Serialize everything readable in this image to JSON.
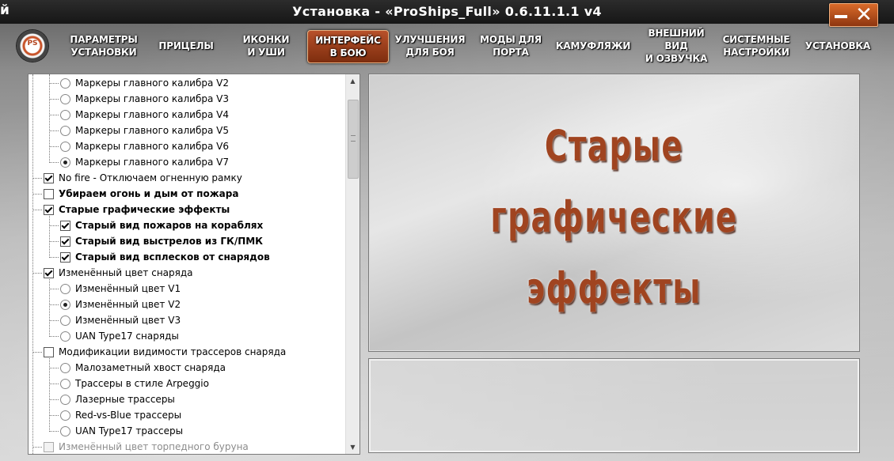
{
  "titlebar": {
    "edge_char": "й",
    "title": "Установка - «ProShips_Full» 0.6.11.1.1 v4"
  },
  "logo": {
    "text": "PS"
  },
  "nav": {
    "items": [
      {
        "label": "ПАРАМЕТРЫ\nУСТАНОВКИ",
        "active": false
      },
      {
        "label": "ПРИЦЕЛЫ",
        "active": false
      },
      {
        "label": "ИКОНКИ\nИ УШИ",
        "active": false
      },
      {
        "label": "ИНТЕРФЕЙС\nВ БОЮ",
        "active": true
      },
      {
        "label": "УЛУЧШЕНИЯ\nДЛЯ БОЯ",
        "active": false
      },
      {
        "label": "МОДЫ ДЛЯ\nПОРТА",
        "active": false
      },
      {
        "label": "КАМУФЛЯЖИ",
        "active": false
      },
      {
        "label": "ВНЕШНИЙ ВИД\nИ ОЗВУЧКА",
        "active": false
      },
      {
        "label": "СИСТЕМНЫЕ\nНАСТРОЙКИ",
        "active": false
      },
      {
        "label": "УСТАНОВКА",
        "active": false
      }
    ]
  },
  "tree": {
    "rows": [
      {
        "type": "radio",
        "level": 1,
        "label": "Маркеры главного калибра V2",
        "checked": false
      },
      {
        "type": "radio",
        "level": 1,
        "label": "Маркеры главного калибра V3",
        "checked": false
      },
      {
        "type": "radio",
        "level": 1,
        "label": "Маркеры главного калибра V4",
        "checked": false
      },
      {
        "type": "radio",
        "level": 1,
        "label": "Маркеры главного калибра V5",
        "checked": false
      },
      {
        "type": "radio",
        "level": 1,
        "label": "Маркеры главного калибра V6",
        "checked": false
      },
      {
        "type": "radio",
        "level": 1,
        "label": "Маркеры главного калибра V7",
        "checked": true
      },
      {
        "type": "check",
        "level": 0,
        "label": "No fire - Отключаем огненную рамку",
        "checked": true
      },
      {
        "type": "check",
        "level": 0,
        "label": "Убираем огонь и дым от пожара",
        "checked": false,
        "bold": true
      },
      {
        "type": "check",
        "level": 0,
        "label": "Старые графические эффекты",
        "checked": true,
        "bold": true
      },
      {
        "type": "check",
        "level": 1,
        "label": "Старый вид пожаров на кораблях",
        "checked": true,
        "bold": true
      },
      {
        "type": "check",
        "level": 1,
        "label": "Старый вид выстрелов из ГК/ПМК",
        "checked": true,
        "bold": true
      },
      {
        "type": "check",
        "level": 1,
        "label": "Старый вид всплесков от снарядов",
        "checked": true,
        "bold": true
      },
      {
        "type": "check",
        "level": 0,
        "label": "Изменённый цвет снаряда",
        "checked": true
      },
      {
        "type": "radio",
        "level": 1,
        "label": "Изменённый цвет V1",
        "checked": false
      },
      {
        "type": "radio",
        "level": 1,
        "label": "Изменённый цвет V2",
        "checked": true
      },
      {
        "type": "radio",
        "level": 1,
        "label": "Изменённый цвет V3",
        "checked": false
      },
      {
        "type": "radio",
        "level": 1,
        "label": "UAN Type17 снаряды",
        "checked": false
      },
      {
        "type": "check",
        "level": 0,
        "label": "Модификации видимости трассеров снаряда",
        "checked": false
      },
      {
        "type": "radio",
        "level": 1,
        "label": "Малозаметный хвост снаряда",
        "checked": false
      },
      {
        "type": "radio",
        "level": 1,
        "label": "Трассеры в стиле Arpeggio",
        "checked": false
      },
      {
        "type": "radio",
        "level": 1,
        "label": "Лазерные трассеры",
        "checked": false
      },
      {
        "type": "radio",
        "level": 1,
        "label": "Red-vs-Blue трассеры",
        "checked": false
      },
      {
        "type": "radio",
        "level": 1,
        "label": "UAN Type17 трассеры",
        "checked": false
      },
      {
        "type": "check",
        "level": 0,
        "label": "Изменённый цвет торпедного буруна",
        "checked": false,
        "disabled": true
      }
    ]
  },
  "scrollbar": {
    "up_arrow": "▲",
    "down_arrow": "▼"
  },
  "preview": {
    "title": "Старые\nграфические\nэффекты"
  },
  "description": {
    "text": ""
  },
  "window_buttons": {
    "close_glyph": "✕"
  }
}
